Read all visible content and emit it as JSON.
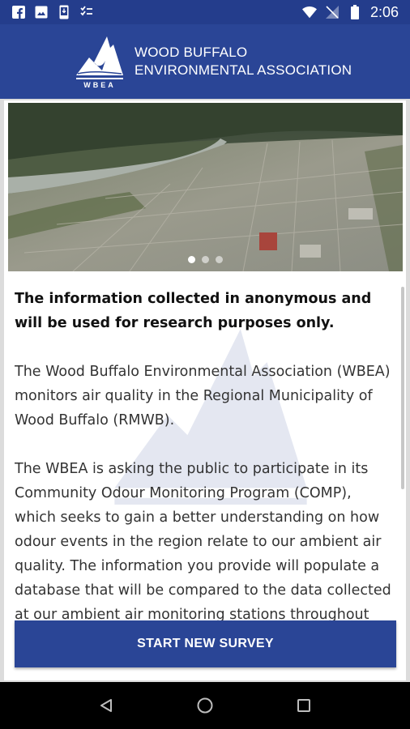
{
  "status_bar": {
    "time": "2:06",
    "icons": [
      "facebook-icon",
      "image-icon",
      "phone-icon",
      "tasks-icon",
      "wifi-icon",
      "no-signal-icon",
      "battery-icon"
    ]
  },
  "header": {
    "logo_text": "WBEA",
    "org_line1": "WOOD BUFFALO",
    "org_line2": "ENVIRONMENTAL ASSOCIATION"
  },
  "carousel": {
    "slide_count": 3,
    "active_index": 0
  },
  "content": {
    "intro_bold": "The information collected in anonymous and will be used for research purposes only.",
    "paragraph1": " The Wood Buffalo Environmental Association (WBEA) monitors air quality in the Regional Municipality of Wood Buffalo (RMWB).",
    "paragraph2": " The WBEA is asking the public to participate in its Community Odour Monitoring Program (COMP), which seeks to gain a better understanding on how odour events in the region relate to our ambient air quality. The information you provide will populate a database that will be compared to the data collected at our ambient air monitoring stations throughout"
  },
  "cta": {
    "label": "START NEW SURVEY"
  },
  "colors": {
    "primary": "#2a4596",
    "status_bar": "#243d8c"
  }
}
